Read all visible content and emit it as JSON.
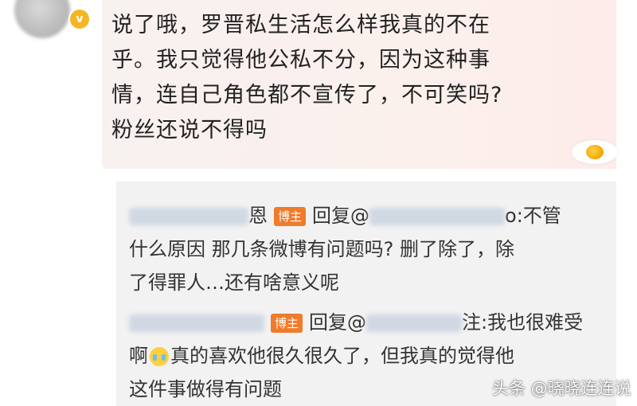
{
  "main_comment": {
    "line1": "说了哦，罗晋私生活怎么样我真的不在",
    "line2": "乎。我只觉得他公私不分，因为这种事",
    "line3": "情，连自己角色都不宣传了，不可笑吗?",
    "line4": "粉丝还说不得吗"
  },
  "replies": [
    {
      "name_visible": "恩",
      "badge": "博主",
      "reply_prefix": "回复@",
      "target_suffix": "o:",
      "line1_text": "不管",
      "line2": "什么原因 那几条微博有问题吗? 删了除了，除",
      "line3": "了得罪人…还有啥意义呢"
    },
    {
      "badge": "博主",
      "reply_prefix": "回复@",
      "target_suffix": "注:",
      "line1_text": "我也很难受",
      "line2_a": "啊",
      "emoji": "crying-face",
      "line2_b": "真的喜欢他很久很久了，但我真的觉得他",
      "line3": "这件事做得有问题"
    }
  ],
  "watermark": "头条 @晓晓连连说",
  "colors": {
    "badge": "#f07b2a",
    "reply_bg": "#f2f2f2",
    "bubble_bg": "#fbf0ec"
  }
}
